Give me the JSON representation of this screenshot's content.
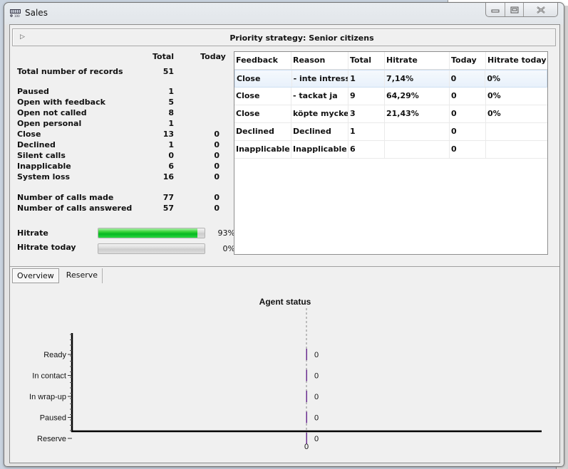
{
  "window": {
    "title": "Sales",
    "buttons": {
      "minimize": "▭",
      "maximize": "▢",
      "close": "✕"
    }
  },
  "strategy": {
    "expand_icon": "▷",
    "title": "Priority strategy: Senior citizens"
  },
  "stats": {
    "header_total": "Total",
    "header_today": "Today",
    "rows": [
      {
        "label": "Total number of records",
        "total": "51",
        "today": ""
      },
      {
        "label": "Paused",
        "total": "1",
        "today": ""
      },
      {
        "label": "Open with feedback",
        "total": "5",
        "today": ""
      },
      {
        "label": "Open not called",
        "total": "8",
        "today": ""
      },
      {
        "label": "Open personal",
        "total": "1",
        "today": ""
      },
      {
        "label": "Close",
        "total": "13",
        "today": "0"
      },
      {
        "label": "Declined",
        "total": "1",
        "today": "0"
      },
      {
        "label": "Silent calls",
        "total": "0",
        "today": "0"
      },
      {
        "label": "Inapplicable",
        "total": "6",
        "today": "0"
      },
      {
        "label": "System loss",
        "total": "16",
        "today": "0"
      },
      {
        "label": "Number of calls made",
        "total": "77",
        "today": "0"
      },
      {
        "label": "Number of calls answered",
        "total": "57",
        "today": "0"
      }
    ],
    "hitrate": {
      "label": "Hitrate",
      "value_text": "93%",
      "fraction": 0.93,
      "color": "#06b822"
    },
    "hitrate_today": {
      "label": "Hitrate today",
      "value_text": "0%",
      "fraction": 0.0
    }
  },
  "feedback_table": {
    "columns": [
      "Feedback",
      "Reason",
      "Total",
      "Hitrate",
      "Today",
      "Hitrate today"
    ],
    "rows": [
      [
        "Close",
        "- inte intresse",
        "1",
        "7,14%",
        "0",
        "0%"
      ],
      [
        "Close",
        "- tackat ja",
        "9",
        "64,29%",
        "0",
        "0%"
      ],
      [
        "Close",
        "köpte mycket",
        "3",
        "21,43%",
        "0",
        "0%"
      ],
      [
        "Declined",
        "Declined",
        "1",
        "",
        "0",
        ""
      ],
      [
        "Inapplicable",
        "Inapplicable",
        "6",
        "",
        "0",
        ""
      ]
    ],
    "selected_row": 0
  },
  "tabs": [
    {
      "label": "Overview",
      "active": true
    },
    {
      "label": "Reserve",
      "active": false
    }
  ],
  "chart_data": {
    "type": "bar",
    "orientation": "horizontal",
    "title": "Agent status",
    "categories": [
      "Ready",
      "In contact",
      "In wrap-up",
      "Paused",
      "Reserve"
    ],
    "values": [
      0,
      0,
      0,
      0,
      0
    ],
    "data_labels": [
      "0",
      "0",
      "0",
      "0",
      "0"
    ],
    "x_ticks": [
      "0"
    ],
    "xlabel": "",
    "ylabel": "",
    "bar_color": "#6a2d8f",
    "grid": false
  }
}
